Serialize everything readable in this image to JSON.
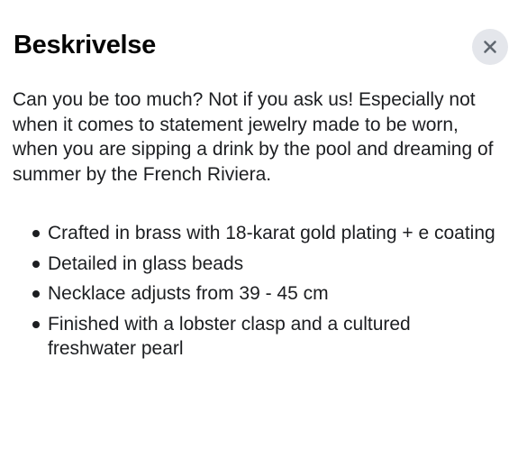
{
  "dialog": {
    "title": "Beskrivelse",
    "close_icon": "close-icon",
    "description": "Can you be too much? Not if you ask us! Especially not when it comes to statement jewelry made to be worn, when you are sipping a drink by the pool and dreaming of summer by the French Riviera.",
    "bullets": [
      "Crafted in brass with 18-karat gold plating + e coating",
      "Detailed in glass beads",
      "Necklace adjusts from 39 - 45 cm",
      "Finished with a lobster clasp and a cultured freshwater pearl"
    ]
  },
  "colors": {
    "background": "#ffffff",
    "text": "#1c1e21",
    "close_button_bg": "#e4e6eb",
    "close_icon": "#606770"
  }
}
